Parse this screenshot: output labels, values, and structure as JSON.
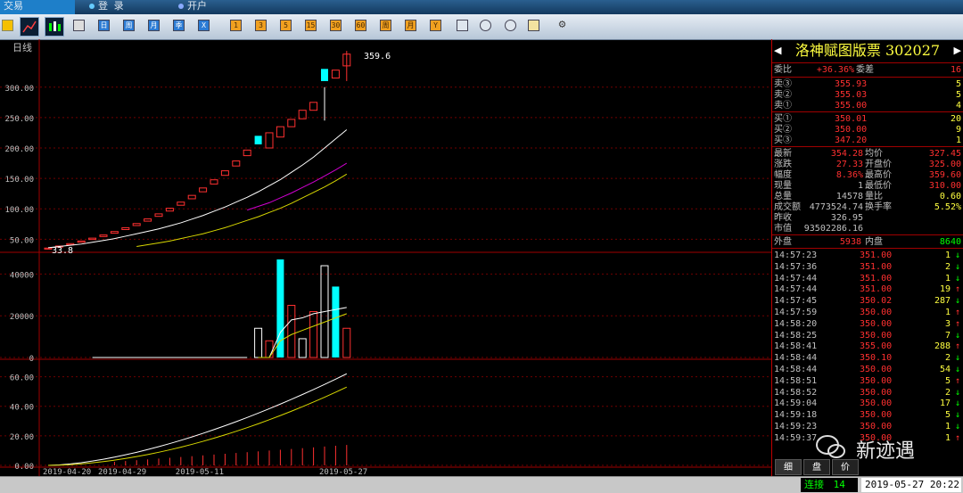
{
  "topbar": {
    "tabs": [
      "交易",
      "登 录",
      "开户"
    ]
  },
  "toolbar": {
    "buttons": [
      "1",
      "3",
      "5",
      "15",
      "30",
      "60",
      "周",
      "月",
      "季",
      "年",
      "Y",
      "X"
    ]
  },
  "chart": {
    "period_label": "日线",
    "price_axis": [
      "300.00",
      "250.00",
      "200.00",
      "150.00",
      "100.00",
      "50.00"
    ],
    "volume_axis": [
      "40000",
      "20000",
      "0"
    ],
    "indicator_axis": [
      "60.00",
      "40.00",
      "20.00",
      "0.00"
    ],
    "date_labels": [
      "2019-04-20",
      "2019-04-29",
      "2019-05-11",
      "2019-05-27"
    ],
    "low_marker": "33.8",
    "high_marker": "359.6"
  },
  "chart_data": {
    "type": "candlestick",
    "ylim": [
      30,
      370
    ],
    "candles": [
      {
        "o": 33.8,
        "c": 35.5
      },
      {
        "o": 37.1,
        "c": 38.9
      },
      {
        "o": 40.8,
        "c": 42.8
      },
      {
        "o": 45.0,
        "c": 47.1
      },
      {
        "o": 49.5,
        "c": 51.8
      },
      {
        "o": 54.4,
        "c": 57.0
      },
      {
        "o": 59.9,
        "c": 62.7
      },
      {
        "o": 65.9,
        "c": 68.9
      },
      {
        "o": 72.5,
        "c": 75.8
      },
      {
        "o": 79.7,
        "c": 83.4
      },
      {
        "o": 87.6,
        "c": 91.7
      },
      {
        "o": 96.3,
        "c": 100.9
      },
      {
        "o": 105.9,
        "c": 111.0
      },
      {
        "o": 116.5,
        "c": 122.1
      },
      {
        "o": 128.0,
        "c": 134.3
      },
      {
        "o": 140.8,
        "c": 147.7
      },
      {
        "o": 155.0,
        "c": 162.5
      },
      {
        "o": 170.4,
        "c": 178.7
      },
      {
        "o": 187.4,
        "c": 196.6
      },
      {
        "o": 206.0,
        "c": 220.0
      },
      {
        "o": 200.0,
        "c": 225.0
      },
      {
        "o": 218.0,
        "c": 235.0
      },
      {
        "o": 235.0,
        "c": 247.0
      },
      {
        "o": 248.0,
        "c": 262.0
      },
      {
        "o": 262.0,
        "c": 275.0
      },
      {
        "o": 330.0,
        "c": 310.0
      },
      {
        "o": 315.0,
        "c": 328.0
      },
      {
        "o": 335.0,
        "c": 354.3
      }
    ],
    "ma5": [
      36,
      38,
      40,
      42,
      45,
      48,
      51,
      55,
      59,
      63,
      67,
      72,
      77,
      83,
      89,
      96,
      103,
      111,
      119,
      128,
      138,
      148,
      160,
      172,
      185,
      200,
      215,
      230
    ],
    "ma10": [
      null,
      null,
      null,
      null,
      null,
      null,
      null,
      null,
      38,
      41,
      44,
      47,
      51,
      55,
      59,
      64,
      69,
      75,
      81,
      87,
      94,
      101,
      109,
      118,
      127,
      136,
      146,
      157
    ],
    "ma20": [
      null,
      null,
      null,
      null,
      null,
      null,
      null,
      null,
      null,
      null,
      null,
      null,
      null,
      null,
      null,
      null,
      null,
      null,
      98,
      104,
      110,
      118,
      126,
      135,
      144,
      154,
      164,
      175
    ],
    "volumes": [
      0,
      0,
      0,
      0,
      0,
      0,
      0,
      0,
      0,
      0,
      0,
      0,
      0,
      0,
      0,
      0,
      0,
      0,
      0,
      14000,
      8000,
      47000,
      25000,
      9000,
      22000,
      44000,
      34000,
      14000
    ],
    "bar_colors": [
      "red",
      "red",
      "red",
      "red",
      "red",
      "red",
      "red",
      "red",
      "red",
      "red",
      "red",
      "red",
      "red",
      "red",
      "red",
      "red",
      "red",
      "red",
      "red",
      "white",
      "red",
      "cyan",
      "red",
      "white",
      "red",
      "white",
      "cyan",
      "red"
    ]
  },
  "panel": {
    "stock_name": "洛神赋图版票 302027",
    "webi": {
      "label": "委比",
      "value": "+36.36%",
      "label2": "委差",
      "value2": "16"
    },
    "asks": [
      {
        "label": "卖③",
        "price": "355.93",
        "vol": "5"
      },
      {
        "label": "卖②",
        "price": "355.03",
        "vol": "5"
      },
      {
        "label": "卖①",
        "price": "355.00",
        "vol": "4"
      }
    ],
    "bids": [
      {
        "label": "买①",
        "price": "350.01",
        "vol": "20"
      },
      {
        "label": "买②",
        "price": "350.00",
        "vol": "9"
      },
      {
        "label": "买③",
        "price": "347.20",
        "vol": "1"
      }
    ],
    "stats": [
      {
        "l1": "最新",
        "v1": "354.28",
        "l2": "均价",
        "v2": "327.45"
      },
      {
        "l1": "涨跌",
        "v1": "27.33",
        "l2": "开盘价",
        "v2": "325.00"
      },
      {
        "l1": "幅度",
        "v1": "8.36%",
        "l2": "最高价",
        "v2": "359.60"
      },
      {
        "l1": "现量",
        "v1": "1",
        "l2": "最低价",
        "v2": "310.00"
      },
      {
        "l1": "总量",
        "v1": "14578",
        "l2": "量比",
        "v2": "0.60"
      },
      {
        "l1": "成交额",
        "v1": "4773524.74",
        "l2": "换手率",
        "v2": "5.52%"
      },
      {
        "l1": "昨收",
        "v1": "326.95",
        "l2": "",
        "v2": ""
      },
      {
        "l1": "市值",
        "v1": "93502286.16",
        "l2": "",
        "v2": ""
      }
    ],
    "outer": {
      "label": "外盘",
      "value": "5938",
      "label2": "内盘",
      "value2": "8640"
    },
    "ticks": [
      {
        "t": "14:57:23",
        "p": "351.00",
        "v": "1",
        "d": "down"
      },
      {
        "t": "14:57:36",
        "p": "351.00",
        "v": "2",
        "d": "down"
      },
      {
        "t": "14:57:44",
        "p": "351.00",
        "v": "1",
        "d": "down"
      },
      {
        "t": "14:57:44",
        "p": "351.00",
        "v": "19",
        "d": "up"
      },
      {
        "t": "14:57:45",
        "p": "350.02",
        "v": "287",
        "d": "down"
      },
      {
        "t": "14:57:59",
        "p": "350.00",
        "v": "1",
        "d": "up"
      },
      {
        "t": "14:58:20",
        "p": "350.00",
        "v": "3",
        "d": "up"
      },
      {
        "t": "14:58:25",
        "p": "350.00",
        "v": "7",
        "d": "down"
      },
      {
        "t": "14:58:41",
        "p": "355.00",
        "v": "288",
        "d": "up"
      },
      {
        "t": "14:58:44",
        "p": "350.10",
        "v": "2",
        "d": "down"
      },
      {
        "t": "14:58:44",
        "p": "350.00",
        "v": "54",
        "d": "down"
      },
      {
        "t": "14:58:51",
        "p": "350.00",
        "v": "5",
        "d": "up"
      },
      {
        "t": "14:58:52",
        "p": "350.00",
        "v": "2",
        "d": "down"
      },
      {
        "t": "14:59:04",
        "p": "350.00",
        "v": "17",
        "d": "down"
      },
      {
        "t": "14:59:18",
        "p": "350.00",
        "v": "5",
        "d": "down"
      },
      {
        "t": "14:59:23",
        "p": "350.00",
        "v": "1",
        "d": "down"
      },
      {
        "t": "14:59:37",
        "p": "350.00",
        "v": "1",
        "d": "up"
      }
    ]
  },
  "bottom_tabs": [
    "细",
    "盘",
    "价"
  ],
  "status": {
    "connect_label": "连接",
    "connect_value": "14",
    "datetime": "2019-05-27 20:22"
  },
  "watermark": "新迹遇"
}
